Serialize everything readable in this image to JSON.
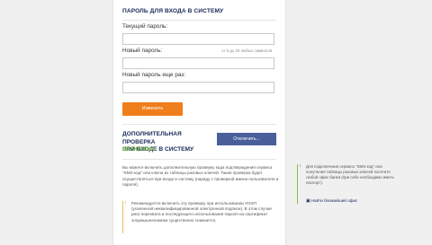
{
  "password_section": {
    "title": "ПАРОЛЬ ДЛЯ ВХОДА В СИСТЕМУ",
    "current_label": "Текущий пароль:",
    "new_label": "Новый пароль:",
    "new_hint": "от 6 до 20 любых символов",
    "repeat_label": "Новый пароль еще раз:",
    "current_value": "",
    "new_value": "",
    "repeat_value": "",
    "change_button": "Изменить"
  },
  "extra_check": {
    "title_line1": "ДОПОЛНИТЕЛЬНАЯ ПРОВЕРКА",
    "title_line2": "ПРИ ВХОДЕ В СИСТЕМУ",
    "status": "ВКЛЮЧЕНА",
    "disable_button": "Отключить...",
    "description": "Вы можете включить дополнительную проверку кода подтверждения сервиса \"SMS-код\" или ключа из таблицы разовых ключей. Такая проверка будет осуществляться при входе в систему (наряду с проверкой имени пользователя и пароля).",
    "note_icon": "i",
    "note": "Рекомендуется включить эту проверку при использовании УНЭП (усиленной неквалифицированной электронной подписи). В этом случае риск перехвата и последующего использования пароля на сертификат злоумышленником существенно снижается."
  },
  "sidebar_info": {
    "icon": "i",
    "text": "Для подключения сервиса \"SMS-код\" или получения таблицы разовых ключей посетите любой офис банка (при себе необходимо иметь паспорт).",
    "link_icon": "office-icon",
    "link_text": "Найти ближайший офис"
  },
  "colors": {
    "accent_orange": "#f07e1b",
    "title_navy": "#1b2a5a",
    "status_green": "#6aac3a",
    "button_blue": "#4a5f9a"
  }
}
